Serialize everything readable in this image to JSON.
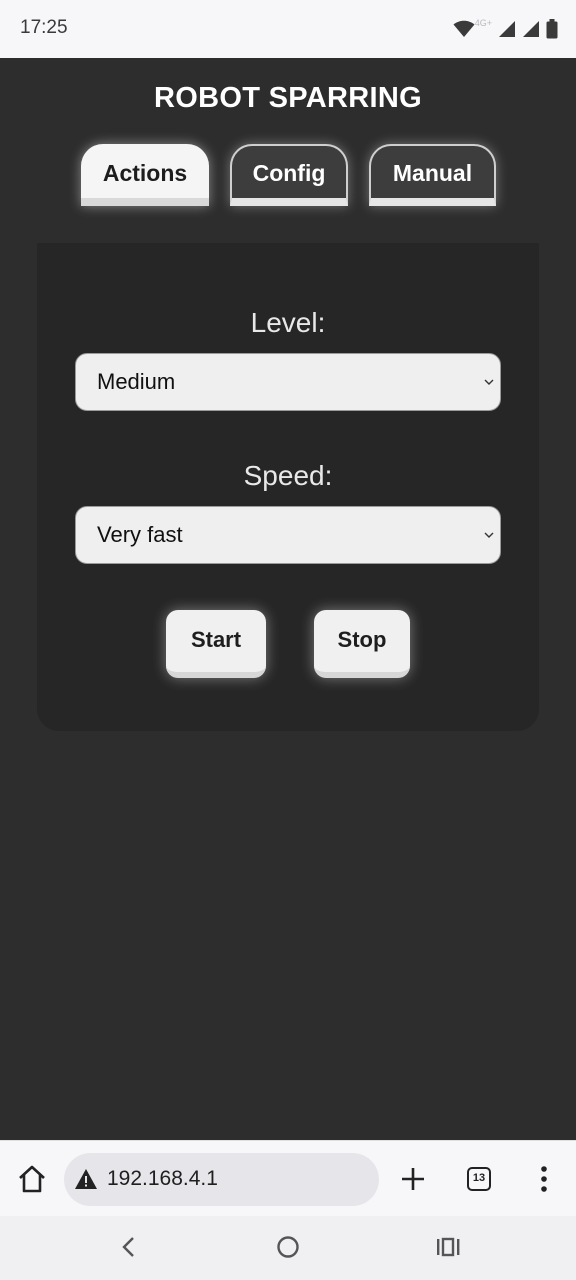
{
  "status_bar": {
    "time": "17:25",
    "network_label": "4G+",
    "icons": [
      "wifi-icon",
      "signal-icon",
      "signal-icon",
      "battery-icon"
    ]
  },
  "app": {
    "title": "ROBOT SPARRING",
    "tabs": [
      {
        "label": "Actions",
        "active": true
      },
      {
        "label": "Config",
        "active": false
      },
      {
        "label": "Manual",
        "active": false
      }
    ],
    "level": {
      "label": "Level:",
      "value": "Medium"
    },
    "speed": {
      "label": "Speed:",
      "value": "Very fast"
    },
    "buttons": {
      "start": "Start",
      "stop": "Stop"
    }
  },
  "browser": {
    "url": "192.168.4.1",
    "tab_count": "13",
    "icons": [
      "home-icon",
      "warning-icon",
      "plus-icon",
      "tab-switcher-icon",
      "more-vert-icon"
    ]
  },
  "nav": {
    "icons": [
      "back-icon",
      "home-circle-icon",
      "recents-icon"
    ]
  },
  "colors": {
    "background": "#2d2d2d",
    "panel": "#262626",
    "tab_active": "#f5f5f5",
    "tab_inactive": "#3d3d3d",
    "button": "#f0f0f0"
  }
}
